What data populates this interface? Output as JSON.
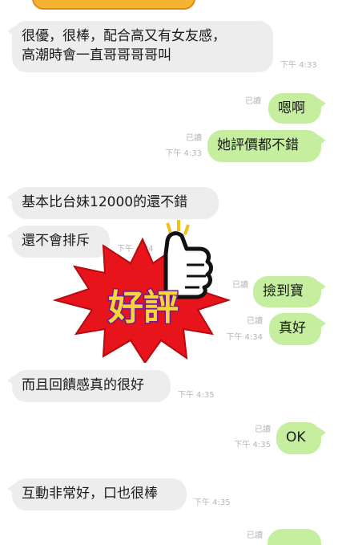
{
  "messages": [
    {
      "side": "in",
      "text": "很優，很棒，配合高又有女友感，\n高潮時會一直哥哥哥哥叫",
      "time": "下午 4:33"
    },
    {
      "side": "out",
      "text": "嗯啊",
      "read": "已讀"
    },
    {
      "side": "out",
      "text": "她評價都不錯",
      "read": "已讀",
      "time": "下午 4:33"
    },
    {
      "side": "in",
      "text": "基本比台妹12000的還不錯"
    },
    {
      "side": "in",
      "text": "還不會排斥",
      "time": "下午 4:34"
    },
    {
      "side": "out",
      "text": "撿到寶",
      "read": "已讀"
    },
    {
      "side": "out",
      "text": "真好",
      "read": "已讀",
      "time": "下午 4:34"
    },
    {
      "side": "in",
      "text": "而且回饋感真的很好",
      "time": "下午 4:35"
    },
    {
      "side": "out",
      "text": "OK",
      "read": "已讀",
      "time": "下午 4:35"
    },
    {
      "side": "in",
      "text": "互動非常好，口也很棒",
      "time": "下午 4:35"
    }
  ],
  "bottom": {
    "read": "已讀"
  },
  "sticker": {
    "text": "好評",
    "name": "thumbs-up-review-sticker"
  },
  "colors": {
    "incoming": "#ededed",
    "outgoing": "#c5ee9f",
    "meta": "#b6b6b6",
    "burst": "#e8141c"
  }
}
